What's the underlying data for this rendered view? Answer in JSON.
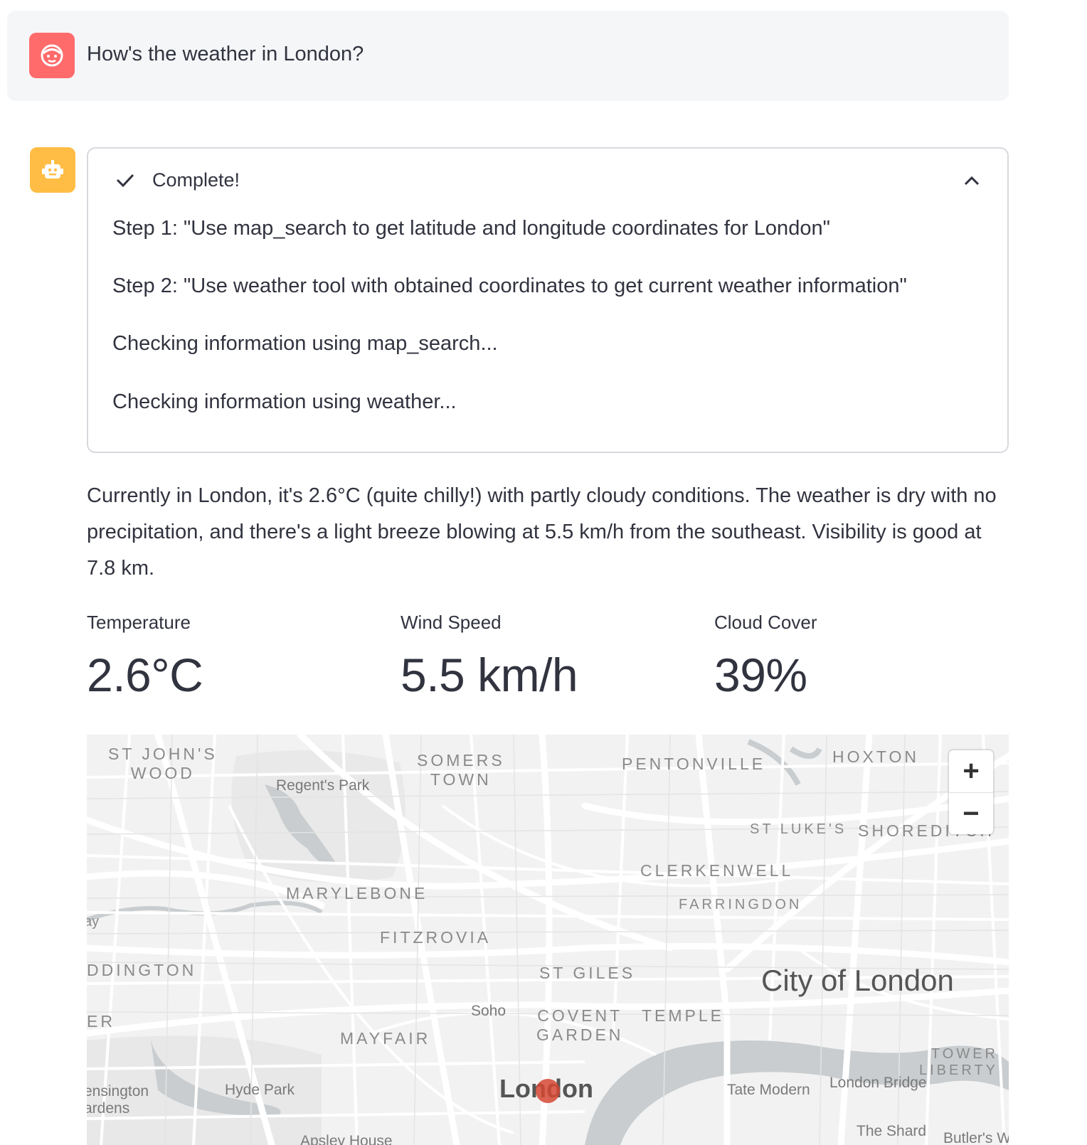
{
  "user_message": {
    "text": "How's the weather in London?",
    "avatar_icon": "face-icon",
    "avatar_color": "#ff6b6b"
  },
  "assistant": {
    "avatar_icon": "robot-icon",
    "avatar_color": "#ffbd45",
    "status": {
      "title": "Complete!",
      "steps": [
        "Step 1: \"Use map_search to get latitude and longitude coordinates for London\"",
        "Step 2: \"Use weather tool with obtained coordinates to get current weather information\"",
        "Checking information using map_search...",
        "Checking information using weather..."
      ]
    },
    "answer": "Currently in London, it's 2.6°C (quite chilly!) with partly cloudy conditions. The weather is dry with no precipitation, and there's a light breeze blowing at 5.5 km/h from the southeast. Visibility is good at 7.8 km.",
    "metrics": [
      {
        "label": "Temperature",
        "value": "2.6°C"
      },
      {
        "label": "Wind Speed",
        "value": "5.5 km/h"
      },
      {
        "label": "Cloud Cover",
        "value": "39%"
      }
    ]
  },
  "map": {
    "zoom_in": "+",
    "zoom_out": "−",
    "labels": {
      "st_johns_wood": "ST JOHN'S\nWOOD",
      "regents_park": "Regent's Park",
      "somers_town": "SOMERS\nTOWN",
      "pentonville": "PENTONVILLE",
      "hoxton": "HOXTON",
      "st_lukes": "ST LUKE'S",
      "shoreditch": "SHOREDITCH",
      "clerkenwell": "CLERKENWELL",
      "farringdon": "FARRINGDON",
      "marylebone": "MARYLEBONE",
      "fitzrovia": "FITZROVIA",
      "paddington": "DDINGTON",
      "st_giles": "ST GILES",
      "city_of_london": "City of London",
      "soho": "Soho",
      "covent_garden": "COVENT\nGARDEN",
      "temple": "TEMPLE",
      "mayfair": "MAYFAIR",
      "er": "ER",
      "ay": "ay",
      "tower": "TOWER\nLIBERTY",
      "kensington": "ensington\nardens",
      "hyde_park": "Hyde Park",
      "london": "London",
      "tate_modern": "Tate Modern",
      "london_bridge": "London Bridge",
      "the_shard": "The Shard",
      "apsley": "Apsley House",
      "butlers": "Butler's W"
    }
  }
}
